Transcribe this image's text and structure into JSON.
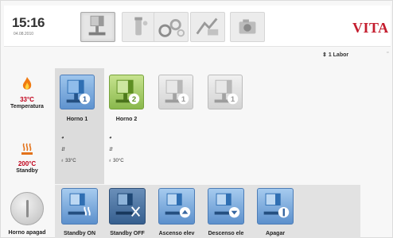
{
  "header": {
    "time": "15:16",
    "date": "04.08.2010",
    "brand": "VITA",
    "tabs": [
      {
        "icon": "furnace-tab-icon"
      },
      {
        "icon": "material-tab-icon"
      },
      {
        "icon": "settings-tab-icon"
      },
      {
        "icon": "tools-tab-icon"
      },
      {
        "icon": "camera-tab-icon"
      }
    ]
  },
  "user_bar": {
    "text": "1 Labor"
  },
  "status": {
    "temperature": {
      "value": "33°C",
      "label": "Temperatura"
    },
    "standby": {
      "value": "200°C",
      "label": "Standby"
    },
    "power": {
      "label": "Horno apagad"
    }
  },
  "furnaces": [
    {
      "name": "Horno 1",
      "number": "1",
      "color": "blue",
      "temp": "33°C"
    },
    {
      "name": "Horno 2",
      "number": "2",
      "color": "green",
      "temp": "30°C"
    },
    {
      "name": "",
      "number": "1",
      "color": "gray"
    },
    {
      "name": "",
      "number": "1",
      "color": "gray"
    }
  ],
  "actions": [
    {
      "label": "Standby ON"
    },
    {
      "label": "Standby OFF"
    },
    {
      "label": "Ascenso elev"
    },
    {
      "label": "Descenso ele"
    },
    {
      "label": "Apagar"
    }
  ],
  "colors": {
    "brand": "#c41d2e",
    "temp_text": "#c0001a",
    "button_blue": "#5f93cf",
    "button_green": "#8ab84c"
  }
}
